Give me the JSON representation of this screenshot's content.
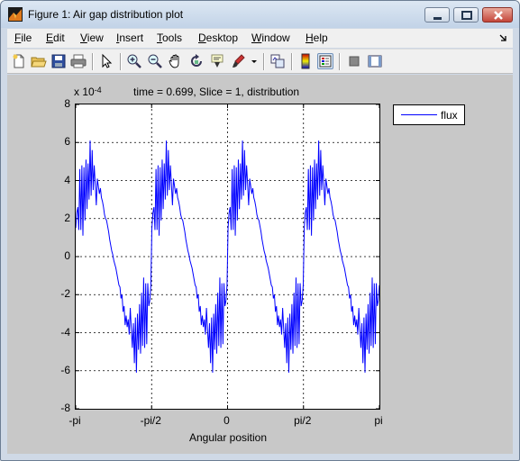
{
  "window": {
    "title": "Figure 1: Air gap distribution plot",
    "buttons": [
      "minimize",
      "maximize",
      "close"
    ]
  },
  "menu": [
    {
      "key": "F",
      "rest": "ile"
    },
    {
      "key": "E",
      "rest": "dit"
    },
    {
      "key": "V",
      "rest": "iew"
    },
    {
      "key": "I",
      "rest": "nsert"
    },
    {
      "key": "T",
      "rest": "ools"
    },
    {
      "key": "D",
      "rest": "esktop"
    },
    {
      "key": "W",
      "rest": "indow"
    },
    {
      "key": "H",
      "rest": "elp"
    }
  ],
  "toolbar": {
    "icons": [
      "new-figure-icon",
      "open-file-icon",
      "save-icon",
      "print-icon",
      "edit-plot-arrow-icon",
      "zoom-in-icon",
      "zoom-out-icon",
      "pan-hand-icon",
      "rotate-3d-icon",
      "data-cursor-icon",
      "brush-icon",
      "brush-dropdown-icon",
      "link-plot-icon",
      "insert-colorbar-icon",
      "insert-legend-icon",
      "hide-plot-tools-icon",
      "show-plot-tools-icon"
    ]
  },
  "colors": {
    "trace": "#0000ff",
    "figure_background": "#c8c8c8",
    "axes_background": "#ffffff"
  },
  "chart_data": {
    "type": "line",
    "title": "time = 0.699, Slice = 1, distribution",
    "exponent_base": "x 10",
    "exponent_power": "-4",
    "xlabel": "Angular position",
    "ylabel": "",
    "x_ticks": [
      "-pi",
      "-pi/2",
      "0",
      "pi/2",
      "pi"
    ],
    "xlim": [
      -3.1416,
      3.1416
    ],
    "ylim": [
      -8,
      8
    ],
    "y_ticks": [
      "8",
      "6",
      "4",
      "2",
      "0",
      "-2",
      "-4",
      "-6",
      "-8"
    ],
    "grid": true,
    "grid_style": "dotted",
    "legend_position": "outside-top-right",
    "series": [
      {
        "name": "flux",
        "color": "#0000ff",
        "period_quarter_samples": [
          1.5,
          2.3,
          2.6,
          1.4,
          4.6,
          1.4,
          4.8,
          1.1,
          4.7,
          1.9,
          5.1,
          2.5,
          4.9,
          3.0,
          6.1,
          3.2,
          5.6,
          3.5,
          4.8,
          3.8,
          2.7,
          4.1,
          3.7,
          3.3,
          3.6,
          3.1,
          2.9,
          2.6,
          2.2,
          2.0,
          1.9,
          1.6,
          1.3,
          0.9,
          0.6,
          0.3,
          0.1,
          -0.2,
          -0.4,
          -0.6,
          -0.9,
          -1.2,
          -1.5,
          -1.6,
          -2.2,
          -2.0,
          -2.9,
          -2.6,
          -3.6,
          -3.1,
          -3.7,
          -3.3,
          -4.1,
          -2.7,
          -3.8,
          -4.8,
          -3.5,
          -5.6,
          -3.2,
          -6.1,
          -3.0,
          -4.9,
          -2.5,
          -5.1,
          -1.9,
          -4.7,
          -1.1,
          -4.8,
          -1.4,
          -4.6,
          -1.4,
          -2.6,
          -2.3,
          -1.5
        ],
        "periods": 4
      }
    ]
  }
}
